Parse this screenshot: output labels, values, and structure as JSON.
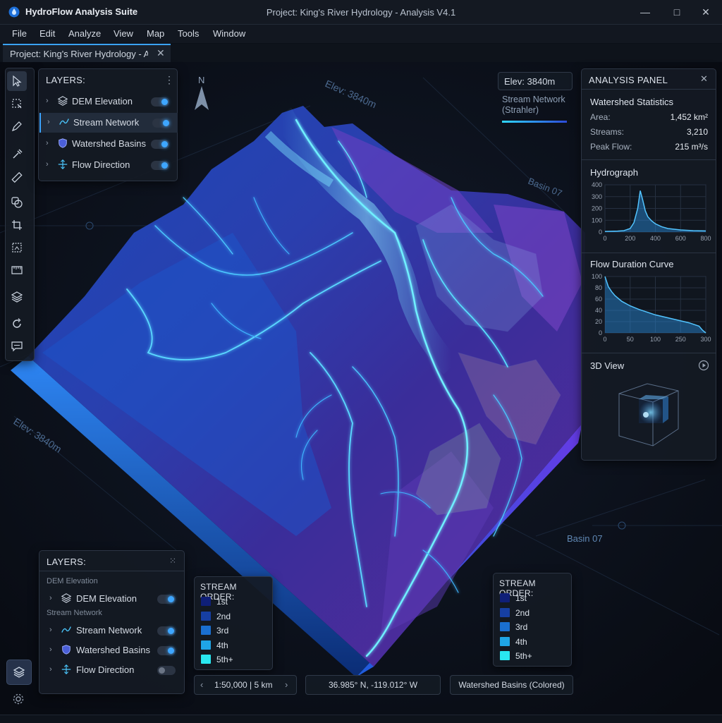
{
  "app": {
    "name": "HydroFlow Analysis Suite",
    "window_title": "Project: King's River Hydrology - Analysis V4.1"
  },
  "window_controls": {
    "minimize": "—",
    "maximize": "□",
    "close": "✕"
  },
  "menu": [
    "File",
    "Edit",
    "Analyze",
    "View",
    "Map",
    "Tools",
    "Window"
  ],
  "tab": {
    "label": "Project: King's River Hydrology - A...",
    "close": "✕"
  },
  "map": {
    "north": "N",
    "elev_labels": [
      "Elev: 3840m",
      "Elev: 3840m"
    ],
    "basin_labels": [
      "Basin 07",
      "Basin 07"
    ],
    "elev_box": "Elev: 3840m",
    "stream_caption": [
      "Stream Network",
      "(Strahler)"
    ]
  },
  "toolbar": [
    "select-arrow-icon",
    "lasso-select-icon",
    "draw-pen-icon",
    "eyedropper-icon",
    "measure-ruler-icon",
    "overlap-icon",
    "crop-icon",
    "image-export-icon",
    "ruler-scale-icon",
    "layers-icon",
    "rotate-icon",
    "comment-icon"
  ],
  "layers_top": {
    "title": "LAYERS:",
    "menu": "⋮",
    "items": [
      {
        "label": "DEM Elevation",
        "icon": "layers-icon",
        "on": true
      },
      {
        "label": "Stream Network",
        "icon": "stream-line-icon",
        "on": true
      },
      {
        "label": "Watershed Basins",
        "icon": "shield-basin-icon",
        "on": true
      },
      {
        "label": "Flow Direction",
        "icon": "flow-direction-icon",
        "on": true
      }
    ]
  },
  "layers_bottom": {
    "title": "LAYERS:",
    "menu": "⁙",
    "groups": [
      {
        "header": "DEM Elevation",
        "items": [
          {
            "label": "DEM Elevation",
            "on": true
          }
        ]
      },
      {
        "header": "Stream Network",
        "items": [
          {
            "label": "Stream Network",
            "on": true
          },
          {
            "label": "Watershed Basins",
            "on": true
          },
          {
            "label": "Flow Direction",
            "on": false
          }
        ]
      }
    ]
  },
  "stream_order_legends": [
    {
      "title": "STREAM ORDER:",
      "items": [
        {
          "label": "1st",
          "color": "#0f1f78"
        },
        {
          "label": "2nd",
          "color": "#163fa3"
        },
        {
          "label": "3rd",
          "color": "#1a6fd0"
        },
        {
          "label": "4th",
          "color": "#1fa5e6"
        },
        {
          "label": "5th+",
          "color": "#29e7f0"
        }
      ]
    },
    {
      "title": "STREAM ORDER:",
      "items": [
        {
          "label": "1st",
          "color": "#0f1f78"
        },
        {
          "label": "2nd",
          "color": "#163fa3"
        },
        {
          "label": "3rd",
          "color": "#1a6fd0"
        },
        {
          "label": "4th",
          "color": "#1fa5e6"
        },
        {
          "label": "5th+",
          "color": "#29e7f0"
        }
      ]
    }
  ],
  "status": {
    "scale": "1:50,000 | 5 km",
    "prev": "‹",
    "next": "›",
    "coords": "36.985° N, -119.012° W",
    "basins_label": "Watershed Basins (Colored)"
  },
  "analysis": {
    "title": "ANALYSIS PANEL",
    "close": "✕",
    "stats_title": "Watershed Statistics",
    "stats": [
      {
        "label": "Area:",
        "value": "1,452 km²"
      },
      {
        "label": "Streams:",
        "value": "3,210"
      },
      {
        "label": "Peak Flow:",
        "value": "215 m³/s"
      }
    ],
    "hydro_title": "Hydrograph",
    "fdc_title": "Flow Duration Curve",
    "view_title": "3D View"
  },
  "chart_data": [
    {
      "type": "area",
      "title": "Hydrograph",
      "x": [
        0,
        100,
        150,
        200,
        230,
        260,
        280,
        300,
        320,
        340,
        370,
        400,
        450,
        500,
        600,
        700,
        800
      ],
      "y": [
        5,
        8,
        12,
        30,
        80,
        200,
        350,
        270,
        180,
        130,
        95,
        70,
        45,
        30,
        18,
        12,
        10
      ],
      "xlim": [
        0,
        800
      ],
      "ylim": [
        0,
        400
      ],
      "xticks": [
        "0",
        "200",
        "400",
        "600",
        "800"
      ],
      "yticks": [
        "0",
        "100",
        "200",
        "300",
        "400"
      ],
      "grid": true
    },
    {
      "type": "area",
      "title": "Flow Duration Curve",
      "x": [
        0,
        10,
        20,
        30,
        50,
        75,
        100,
        150,
        200,
        250,
        280,
        290,
        300
      ],
      "y": [
        100,
        82,
        73,
        66,
        56,
        48,
        42,
        32,
        25,
        18,
        12,
        5,
        0
      ],
      "xlim": [
        0,
        300
      ],
      "ylim": [
        0,
        100
      ],
      "xticks": [
        "0",
        "50",
        "100",
        "250",
        "300"
      ],
      "yticks": [
        "0",
        "20",
        "40",
        "60",
        "80",
        "100"
      ],
      "grid": true
    }
  ],
  "bottom_left": {
    "layers_icon": "layers-icon",
    "settings_icon": "gear-icon"
  }
}
